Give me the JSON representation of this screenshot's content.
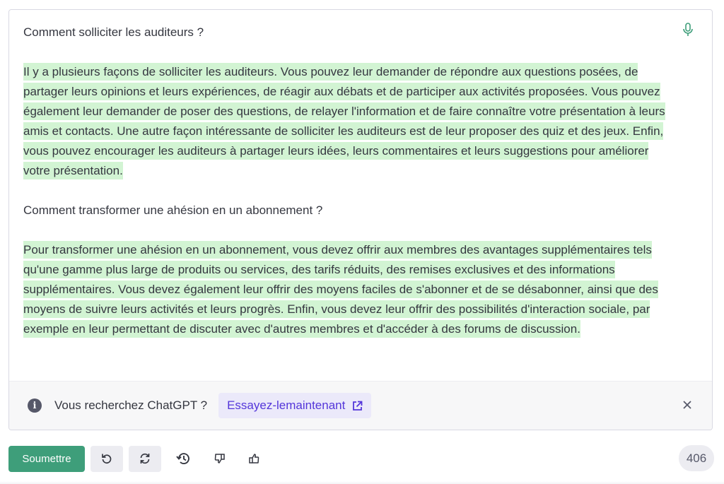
{
  "editor": {
    "question1": "Comment solliciter les auditeurs ?",
    "answer1": "Il y a plusieurs façons de solliciter les auditeurs. Vous pouvez leur demander de répondre aux questions posées, de partager leurs opinions et leurs expériences, de réagir aux débats et de participer aux activités proposées. Vous pouvez également leur demander de poser des questions, de relayer l'information et de faire connaître votre présentation à leurs amis et contacts. Une autre façon intéressante de solliciter les auditeurs est de leur proposer des quiz et des jeux. Enfin, vous pouvez encourager les auditeurs à partager leurs idées, leurs commentaires et leurs suggestions pour améliorer votre présentation.",
    "question2": "Comment transformer une ahésion en un abonnement ?",
    "answer2": "Pour transformer une ahésion en un abonnement, vous devez offrir aux membres des avantages supplémentaires tels qu'une gamme plus large de produits ou services, des tarifs réduits, des remises exclusives et des informations supplémentaires. Vous devez également leur offrir des moyens faciles de s'abonner et de se désabonner, ainsi que des moyens de suivre leurs activités et leurs progrès. Enfin, vous devez leur offrir des possibilités d'interaction sociale, par exemple en leur permettant de discuter avec d'autres membres et d'accéder à des forums de discussion.",
    "highlight_color": "#d2f4d3",
    "mic_icon": "microphone-icon"
  },
  "banner": {
    "text": "Vous recherchez ChatGPT ?",
    "link_label": "Essayez-lemaintenant",
    "link_color": "#5436da",
    "info_icon": "info-icon",
    "external_icon": "external-link-icon",
    "close_icon": "close-icon"
  },
  "toolbar": {
    "submit_label": "Soumettre",
    "submit_color": "#3e9e7a",
    "icons": [
      "undo-icon",
      "redo-icon",
      "history-icon",
      "thumbs-down-icon",
      "thumbs-up-icon"
    ],
    "counter": "406"
  }
}
